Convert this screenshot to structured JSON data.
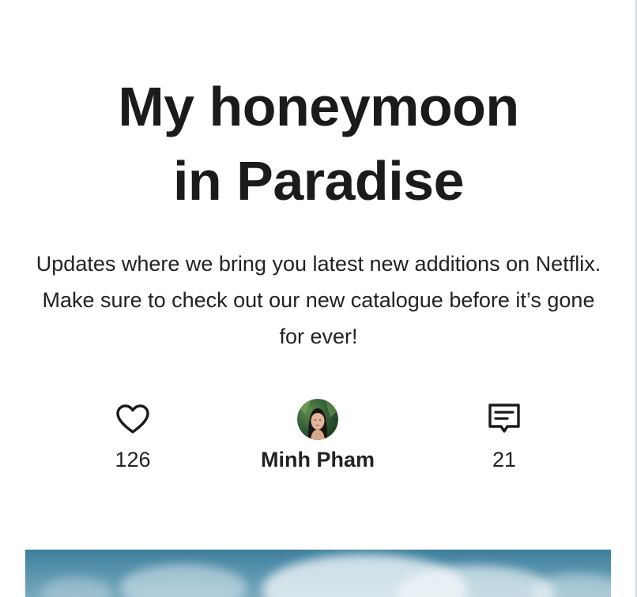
{
  "post": {
    "title_line1": "My honeymoon",
    "title_line2": "in Paradise",
    "description": "Updates where we bring you latest new additions on Netflix. Make sure to check out our new catalogue before it’s gone for ever!"
  },
  "stats": {
    "likes": {
      "icon": "heart-icon",
      "count": "126"
    },
    "author": {
      "icon": "avatar",
      "name": "Minh Pham"
    },
    "comments": {
      "icon": "comment-icon",
      "count": "21"
    }
  },
  "hero": {
    "icon": "cover-image",
    "sky_color": "#4f8fab"
  }
}
